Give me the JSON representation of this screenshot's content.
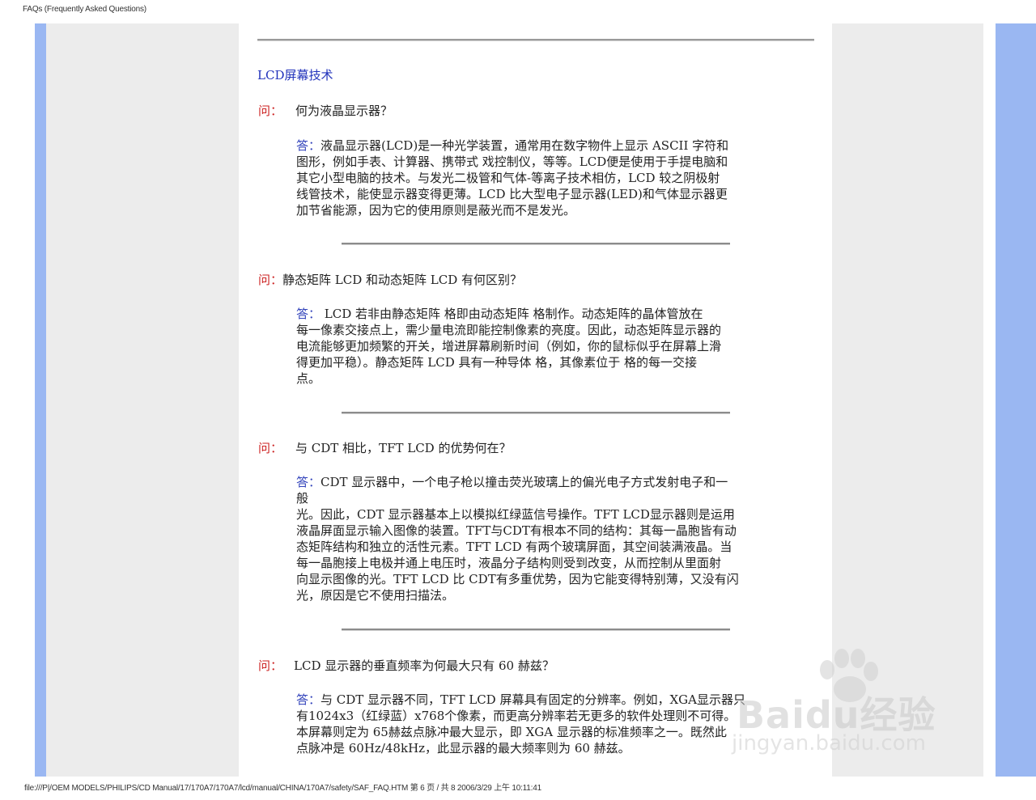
{
  "header": {
    "title": "FAQs (Frequently Asked Questions)"
  },
  "section": {
    "title": "LCD屏幕技术"
  },
  "labels": {
    "question": "问：",
    "answer": "答："
  },
  "qa": [
    {
      "question": "何为液晶显示器？",
      "answer_lines": [
        "液晶显示器(LCD)是一种光学装置，通常用在数字物件上显示 ASCII 字符和",
        "图形，例如手表、计算器、携带式  戏控制仪，等等。LCD便是使用于手提电脑和",
        "其它小型电脑的技术。与发光二极管和气体-等离子技术相仿，LCD 较之阴极射",
        "线管技术，能使显示器变得更薄。LCD 比大型电子显示器(LED)和气体显示器更",
        "加节省能源，因为它的使用原则是蔽光而不是发光。"
      ]
    },
    {
      "question": "静态矩阵 LCD 和动态矩阵 LCD 有何区别？",
      "answer_lines": [
        " LCD 若非由静态矩阵  格即由动态矩阵  格制作。动态矩阵的晶体管放在",
        "每一像素交接点上，需少量电流即能控制像素的亮度。因此，动态矩阵显示器的",
        "电流能够更加频繁的开关，增进屏幕刷新时间（例如，你的鼠标似乎在屏幕上滑",
        "得更加平稳）。静态矩阵 LCD 具有一种导体  格，其像素位于  格的每一交接",
        "点。"
      ]
    },
    {
      "question": "与 CDT 相比，TFT LCD 的优势何在？",
      "answer_lines": [
        "CDT 显示器中，一个电子枪以撞击荧光玻璃上的偏光电子方式发射电子和一",
        "般",
        "光。因此，CDT 显示器基本上以模拟红绿蓝信号操作。TFT LCD显示器则是运用",
        "液晶屏面显示输入图像的装置。TFT与CDT有根本不同的结构：其每一晶胞皆有动",
        "态矩阵结构和独立的活性元素。TFT LCD 有两个玻璃屏面，其空间装满液晶。当",
        "每一晶胞接上电极并通上电压时，液晶分子结构则受到改变，从而控制从里面射",
        "向显示图像的光。TFT LCD 比 CDT有多重优势，因为它能变得特别薄，又没有闪",
        "光，原因是它不使用扫描法。"
      ]
    },
    {
      "question": "LCD 显示器的垂直频率为何最大只有 60 赫兹？",
      "answer_lines": [
        "与 CDT 显示器不同，TFT LCD 屏幕具有固定的分辨率。例如，XGA显示器只",
        "有1024x3（红绿蓝）x768个像素，而更高分辨率若无更多的软件处理则不可得。",
        "本屏幕则定为 65赫兹点脉冲最大显示，即 XGA 显示器的标准频率之一。既然此",
        "点脉冲是 60Hz/48kHz，此显示器的最大频率则为 60 赫兹。"
      ]
    }
  ],
  "footer": {
    "path": "file:///P|/OEM MODELS/PHILIPS/CD Manual/17/170A7/170A7/lcd/manual/CHINA/170A7/safety/SAF_FAQ.HTM",
    "page_info": "第 6 页 / 共 8 2006/3/29 上午 10:11:41"
  },
  "watermark": {
    "logo_text": "Baidu经验",
    "url": "jingyan.baidu.com"
  }
}
